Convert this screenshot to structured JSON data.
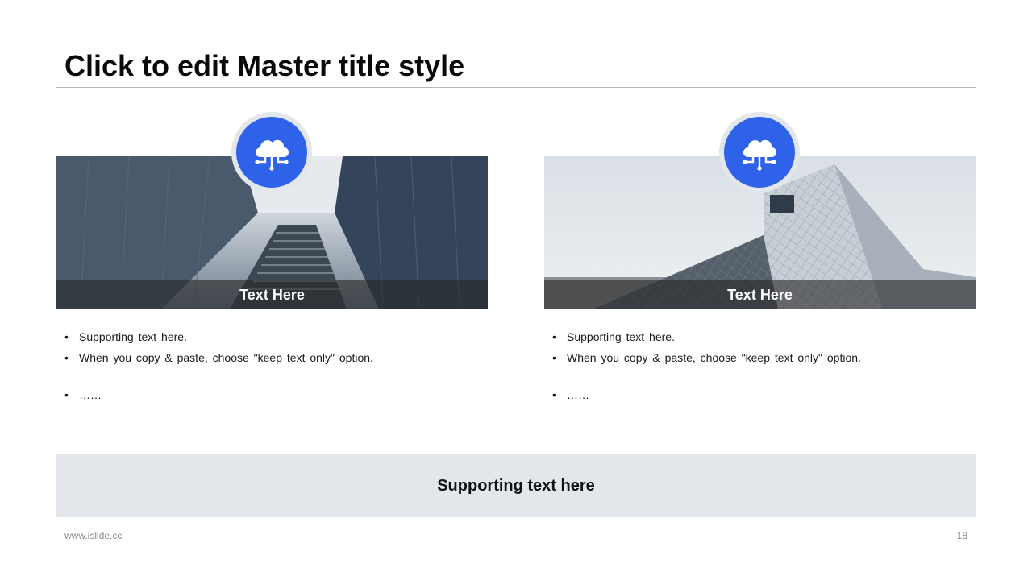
{
  "slide": {
    "title": "Click to edit Master title style"
  },
  "cards": [
    {
      "caption": "Text Here",
      "icon": "cloud-network-icon",
      "bullets": [
        "Supporting text here.",
        "When you copy & paste, choose \"keep text only\" option.",
        "……"
      ]
    },
    {
      "caption": "Text Here",
      "icon": "cloud-network-icon",
      "bullets": [
        "Supporting text here.",
        "When you copy & paste, choose \"keep text only\" option.",
        "……"
      ]
    }
  ],
  "bottom_bar": {
    "text": "Supporting text here"
  },
  "footer": {
    "url": "www.islide.cc",
    "page_number": "18"
  },
  "colors": {
    "accent": "#2e62e8",
    "panel": "#e3e6ea",
    "rule": "#b8b8b8"
  }
}
